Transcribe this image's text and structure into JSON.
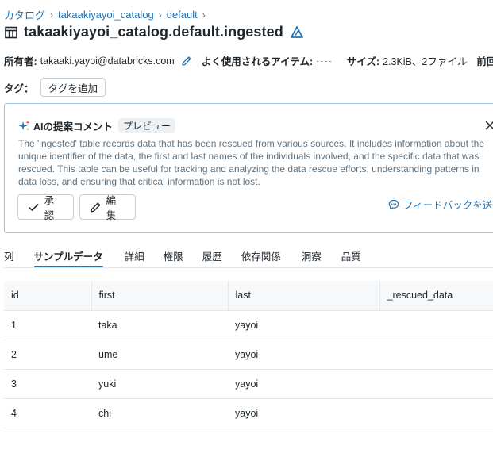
{
  "breadcrumb": {
    "items": [
      "カタログ",
      "takaakiyayoi_catalog",
      "default"
    ],
    "separator": "›"
  },
  "title": "takaakiyayoi_catalog.default.ingested",
  "meta": {
    "owner_label": "所有者:",
    "owner_value": "takaaki.yayoi@databricks.com",
    "frequent_label": "よく使用されるアイテム:",
    "frequent_value": "----",
    "size_label": "サイズ:",
    "size_value": "2.3KiB、2ファイル",
    "last_label": "前回更"
  },
  "tags": {
    "label": "タグ：",
    "add_button": "タグを追加"
  },
  "ai_comment": {
    "title": "AIの提案コメント",
    "badge": "プレビュー",
    "body": "The 'ingested' table records data that has been rescued from various sources. It includes information about the unique identifier of the data, the first and last names of the individuals involved, and the specific data that was rescued. This table can be useful for tracking and analyzing the data rescue efforts, understanding patterns in data loss, and ensuring that critical information is not lost.",
    "approve_label": "承認",
    "edit_label": "編集",
    "feedback_label": "フィードバックを送信"
  },
  "tabs": [
    {
      "label": "列",
      "active": false
    },
    {
      "label": "サンプルデータ",
      "active": true
    },
    {
      "label": "詳細",
      "active": false
    },
    {
      "label": "権限",
      "active": false
    },
    {
      "label": "履歴",
      "active": false
    },
    {
      "label": "依存関係",
      "active": false
    },
    {
      "label": "洞察",
      "active": false
    },
    {
      "label": "品質",
      "active": false
    }
  ],
  "table": {
    "columns": [
      "id",
      "first",
      "last",
      "_rescued_data"
    ],
    "rows": [
      [
        "1",
        "taka",
        "yayoi",
        ""
      ],
      [
        "2",
        "ume",
        "yayoi",
        ""
      ],
      [
        "3",
        "yuki",
        "yayoi",
        ""
      ],
      [
        "4",
        "chi",
        "yayoi",
        ""
      ]
    ]
  },
  "colors": {
    "link": "#2272b4",
    "text": "#1f272d",
    "muted": "#5f7281",
    "card_border": "#9ec3e6",
    "delta_blue": "#0a84ff"
  }
}
